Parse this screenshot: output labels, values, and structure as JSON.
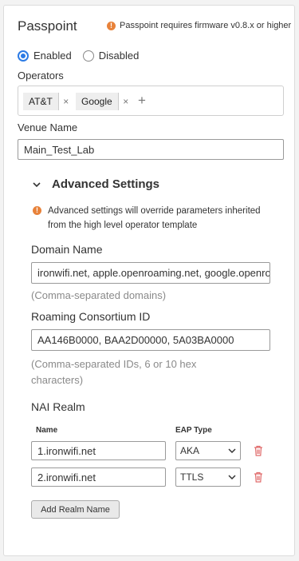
{
  "passpoint": {
    "title": "Passpoint",
    "firmware_warning": "Passpoint requires firmware v0.8.x or higher",
    "status_options": [
      {
        "label": "Enabled",
        "selected": true
      },
      {
        "label": "Disabled",
        "selected": false
      }
    ],
    "operators_label": "Operators",
    "operators": [
      "AT&T",
      "Google"
    ],
    "chip_remove": "×",
    "add_operator": "+",
    "venue_label": "Venue Name",
    "venue_value": "Main_Test_Lab"
  },
  "advanced": {
    "title": "Advanced Settings",
    "expanded": true,
    "warning": "Advanced settings will override parameters inherited from the high level operator template",
    "domain_label": "Domain Name",
    "domain_value": "ironwifi.net, apple.openroaming.net, google.openroaming.net",
    "domain_hint": "(Comma-separated domains)",
    "roaming_label": "Roaming Consortium ID",
    "roaming_value": "AA146B0000, BAA2D00000, 5A03BA0000",
    "roaming_hint": "(Comma-separated IDs, 6 or 10 hex characters)",
    "nai_label": "NAI Realm",
    "col_name": "Name",
    "col_eap": "EAP Type",
    "realms": [
      {
        "name": "1.ironwifi.net",
        "eap": "AKA"
      },
      {
        "name": "2.ironwifi.net",
        "eap": "TTLS"
      }
    ],
    "add_realm_label": "Add Realm Name"
  },
  "colors": {
    "accent": "#2c7be5",
    "warning": "#e8823a",
    "delete": "#e06a6a"
  },
  "icons": [
    "warning-icon",
    "chevron-down-icon",
    "trash-icon",
    "close-icon",
    "plus-icon"
  ]
}
